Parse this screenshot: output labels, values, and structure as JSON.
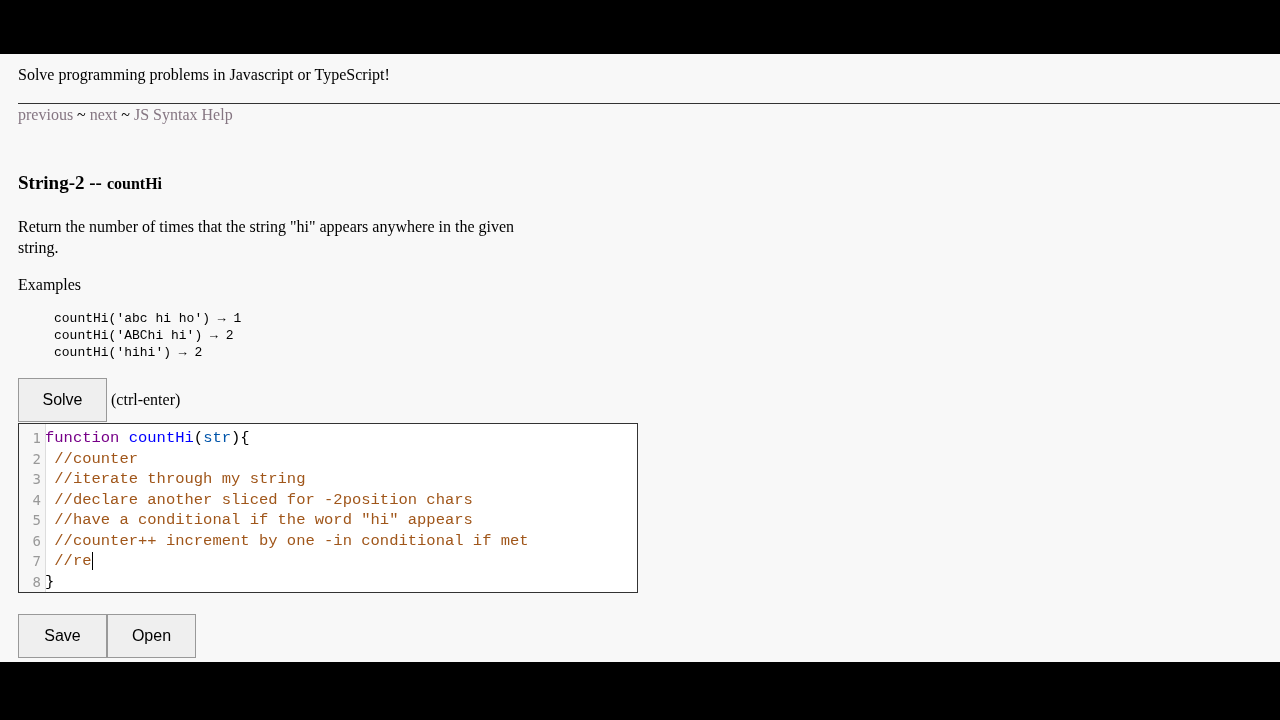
{
  "tagline": "Solve programming problems in Javascript or TypeScript!",
  "nav": [
    {
      "kind": "link",
      "text": "previous"
    },
    {
      "kind": "sep",
      "text": "~"
    },
    {
      "kind": "link",
      "text": "next"
    },
    {
      "kind": "sep",
      "text": "~"
    },
    {
      "kind": "link",
      "text": "JS Syntax Help"
    }
  ],
  "heading": {
    "group": "String-2 --",
    "name": "countHi"
  },
  "description": "Return the number of times that the string \"hi\" appears anywhere in the given string.",
  "examples_label": "Examples",
  "examples": [
    "countHi('abc hi ho') → 1",
    "countHi('ABChi hi') → 2",
    "countHi('hihi') → 2"
  ],
  "solve_button": "Solve",
  "solve_hint": "(ctrl-enter)",
  "editor": {
    "lines": [
      {
        "number": "1",
        "indent": false,
        "has_cursor": false,
        "tokens": [
          {
            "kind": "keyword",
            "text": "function"
          },
          {
            "kind": "def",
            "text": "countHi"
          },
          {
            "kind": "plain",
            "text": "("
          },
          {
            "kind": "variable",
            "text": "str"
          },
          {
            "kind": "plain",
            "text": "){"
          }
        ]
      },
      {
        "number": "2",
        "indent": true,
        "has_cursor": false,
        "tokens": [
          {
            "kind": "comment",
            "text": "//counter"
          }
        ]
      },
      {
        "number": "3",
        "indent": true,
        "has_cursor": false,
        "tokens": [
          {
            "kind": "comment",
            "text": "//iterate through my string"
          }
        ]
      },
      {
        "number": "4",
        "indent": true,
        "has_cursor": false,
        "tokens": [
          {
            "kind": "comment",
            "text": "//declare another sliced for -2position chars"
          }
        ]
      },
      {
        "number": "5",
        "indent": true,
        "has_cursor": false,
        "tokens": [
          {
            "kind": "comment",
            "text": "//have a conditional if the word \"hi\" appears"
          }
        ]
      },
      {
        "number": "6",
        "indent": true,
        "has_cursor": false,
        "tokens": [
          {
            "kind": "comment",
            "text": "//counter++ increment by one -in conditional if met"
          }
        ]
      },
      {
        "number": "7",
        "indent": true,
        "has_cursor": true,
        "tokens": [
          {
            "kind": "comment",
            "text": "//re"
          }
        ]
      },
      {
        "number": "8",
        "indent": false,
        "has_cursor": false,
        "tokens": [
          {
            "kind": "plain",
            "text": "}"
          }
        ]
      }
    ]
  },
  "bottom_buttons": [
    "Save",
    "Open"
  ]
}
